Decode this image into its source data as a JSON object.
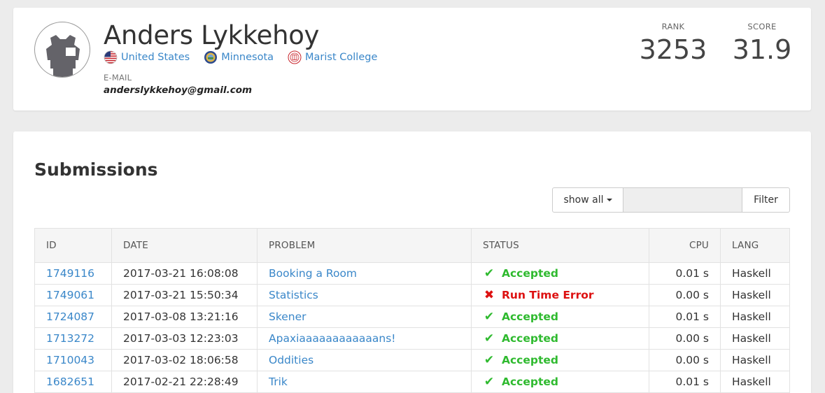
{
  "profile": {
    "name": "Anders Lykkehoy",
    "affiliations": [
      {
        "label": "United States",
        "icon": "us-flag-icon"
      },
      {
        "label": "Minnesota",
        "icon": "minnesota-seal-icon"
      },
      {
        "label": "Marist College",
        "icon": "marist-college-seal-icon"
      }
    ],
    "email_label": "E-MAIL",
    "email": "anderslykkehoy@gmail.com",
    "rank_label": "RANK",
    "rank": "3253",
    "score_label": "SCORE",
    "score": "31.9"
  },
  "submissions": {
    "title": "Submissions",
    "filter_dropdown": "show all",
    "filter_input_value": "",
    "filter_button": "Filter",
    "columns": [
      "ID",
      "DATE",
      "PROBLEM",
      "STATUS",
      "CPU",
      "LANG"
    ],
    "rows": [
      {
        "id": "1749116",
        "date": "2017-03-21 16:08:08",
        "problem": "Booking a Room",
        "status": "Accepted",
        "ok": true,
        "cpu": "0.01 s",
        "lang": "Haskell"
      },
      {
        "id": "1749061",
        "date": "2017-03-21 15:50:34",
        "problem": "Statistics",
        "status": "Run Time Error",
        "ok": false,
        "cpu": "0.00 s",
        "lang": "Haskell"
      },
      {
        "id": "1724087",
        "date": "2017-03-08 13:21:16",
        "problem": "Skener",
        "status": "Accepted",
        "ok": true,
        "cpu": "0.01 s",
        "lang": "Haskell"
      },
      {
        "id": "1713272",
        "date": "2017-03-03 12:23:03",
        "problem": "Apaxiaaaaaaaaaaaans!",
        "status": "Accepted",
        "ok": true,
        "cpu": "0.00 s",
        "lang": "Haskell"
      },
      {
        "id": "1710043",
        "date": "2017-03-02 18:06:58",
        "problem": "Oddities",
        "status": "Accepted",
        "ok": true,
        "cpu": "0.00 s",
        "lang": "Haskell"
      },
      {
        "id": "1682651",
        "date": "2017-02-21 22:28:49",
        "problem": "Trik",
        "status": "Accepted",
        "ok": true,
        "cpu": "0.01 s",
        "lang": "Haskell"
      }
    ]
  },
  "colors": {
    "link": "#3a87c9",
    "accepted": "#2fba2f",
    "error": "#dd1111",
    "background": "#ececec"
  }
}
